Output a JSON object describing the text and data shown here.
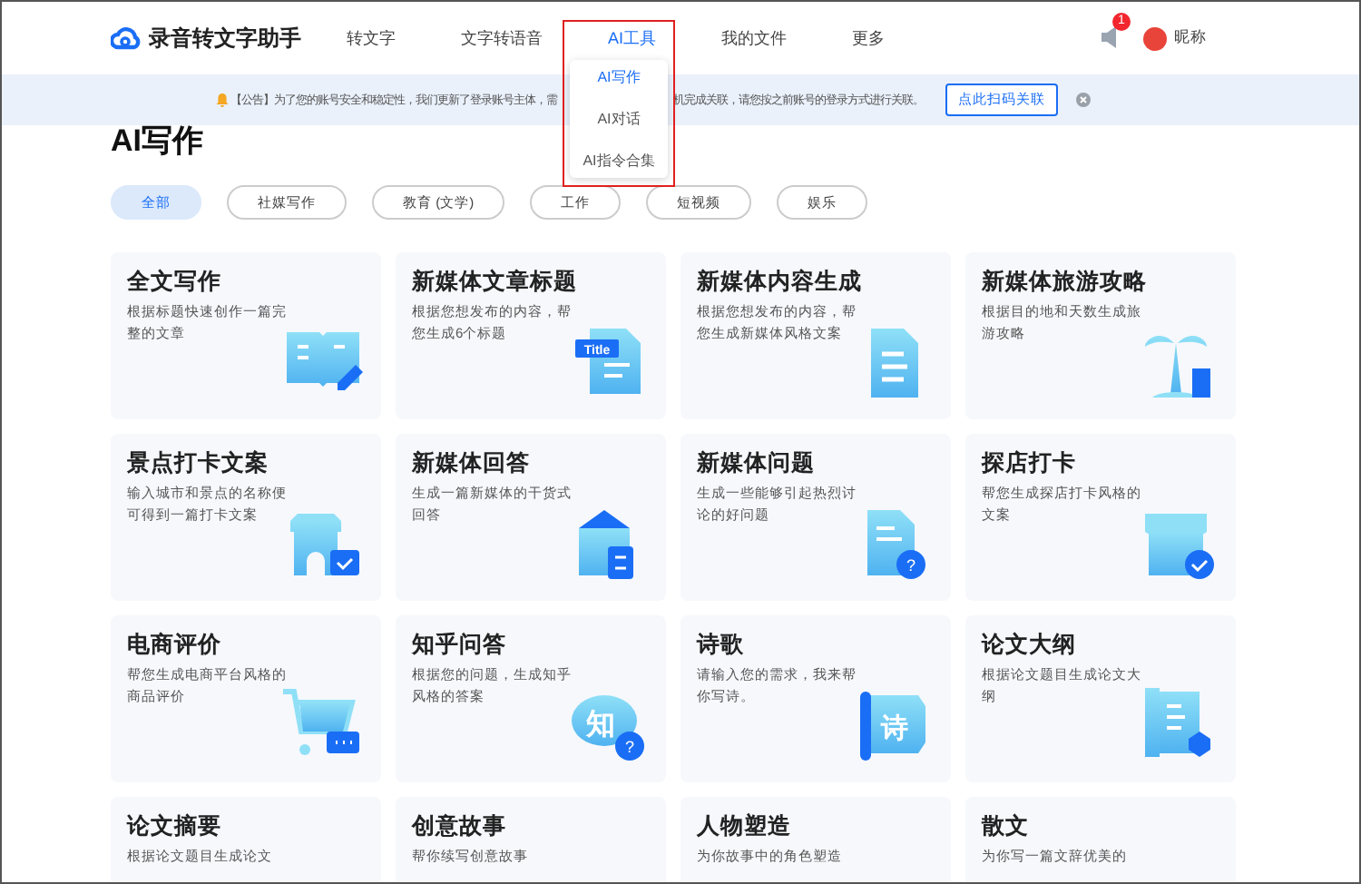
{
  "header": {
    "logo_text": "录音转文字助手",
    "nav": [
      {
        "label": "转文字",
        "selected": false
      },
      {
        "label": "文字转语音",
        "selected": false
      },
      {
        "label": "AI工具",
        "selected": true
      },
      {
        "label": "我的文件",
        "selected": false
      },
      {
        "label": "更多",
        "selected": false
      }
    ],
    "notification_count": "1",
    "username": "昵称"
  },
  "dropdown": {
    "items": [
      {
        "label": "AI写作",
        "selected": true
      },
      {
        "label": "AI对话",
        "selected": false
      },
      {
        "label": "AI指令合集",
        "selected": false
      }
    ]
  },
  "notice": {
    "text_before": "【公告】为了您的账号安全和稳定性，我们更新了登录账号主体，需",
    "text_after": "机完成关联，请您按之前账号的登录方式进行关联。",
    "button": "点此扫码关联"
  },
  "page_title": "AI写作",
  "filters": [
    {
      "label": "全部",
      "selected": true
    },
    {
      "label": "社媒写作",
      "selected": false
    },
    {
      "label": "教育 (文学)",
      "selected": false
    },
    {
      "label": "工作",
      "selected": false
    },
    {
      "label": "短视频",
      "selected": false
    },
    {
      "label": "娱乐",
      "selected": false
    }
  ],
  "cards": [
    {
      "title": "全文写作",
      "description": "根据标题快速创作一篇完整的文章"
    },
    {
      "title": "新媒体文章标题",
      "description": "根据您想发布的内容，帮您生成6个标题",
      "icon_labels": [
        "Title"
      ]
    },
    {
      "title": "新媒体内容生成",
      "description": "根据您想发布的内容，帮您生成新媒体风格文案"
    },
    {
      "title": "新媒体旅游攻略",
      "description": "根据目的地和天数生成旅游攻略"
    },
    {
      "title": "景点打卡文案",
      "description": "输入城市和景点的名称便可得到一篇打卡文案"
    },
    {
      "title": "新媒体回答",
      "description": "生成一篇新媒体的干货式回答"
    },
    {
      "title": "新媒体问题",
      "description": "生成一些能够引起热烈讨论的好问题",
      "icon_labels": [
        "?"
      ]
    },
    {
      "title": "探店打卡",
      "description": "帮您生成探店打卡风格的文案"
    },
    {
      "title": "电商评价",
      "description": "帮您生成电商平台风格的商品评价"
    },
    {
      "title": "知乎问答",
      "description": "根据您的问题，生成知乎风格的答案",
      "icon_labels": [
        "知",
        "?"
      ]
    },
    {
      "title": "诗歌",
      "description": "请输入您的需求，我来帮你写诗。",
      "icon_labels": [
        "诗"
      ]
    },
    {
      "title": "论文大纲",
      "description": "根据论文题目生成论文大纲"
    },
    {
      "title": "论文摘要",
      "description": "根据论文题目生成论文"
    },
    {
      "title": "创意故事",
      "description": "帮你续写创意故事"
    },
    {
      "title": "人物塑造",
      "description": "为你故事中的角色塑造"
    },
    {
      "title": "散文",
      "description": "为你写一篇文辞优美的"
    }
  ]
}
